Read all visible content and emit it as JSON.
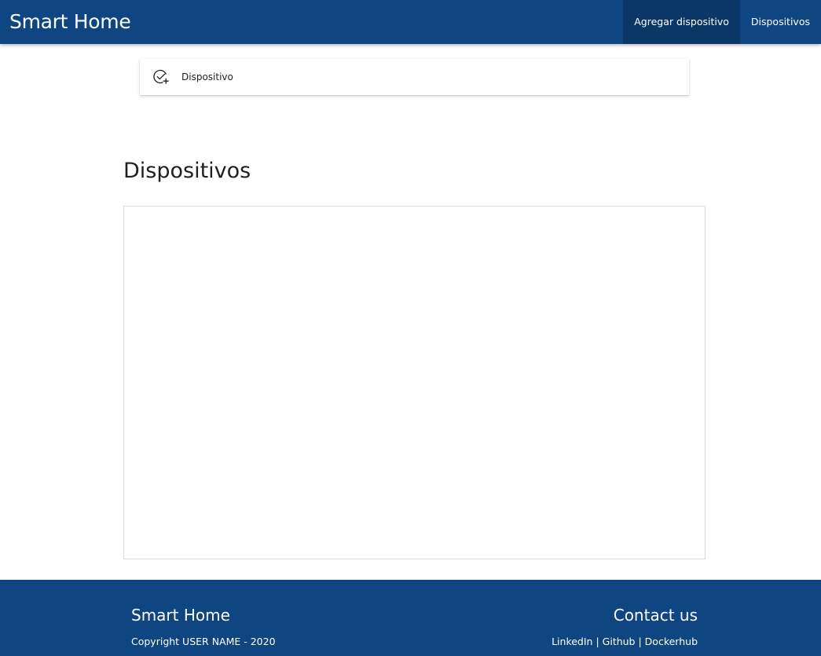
{
  "header": {
    "brand": "Smart Home",
    "nav": [
      {
        "label": "Agregar dispositivo"
      },
      {
        "label": "Dispositivos"
      }
    ]
  },
  "command_bar": {
    "add_device": {
      "label": "Dispositivo",
      "icon": "add-check-circle-icon"
    }
  },
  "main": {
    "title": "Dispositivos"
  },
  "footer": {
    "brand": "Smart Home",
    "copyright": "Copyright USER NAME - 2020",
    "contact_title": "Contact us",
    "links": [
      {
        "label": "LinkedIn"
      },
      {
        "label": "Github"
      },
      {
        "label": "Dockerhub"
      }
    ],
    "separator": " | "
  },
  "colors": {
    "primary": "#0f4580",
    "nav_active": "#0b3766",
    "text": "#201f1e"
  }
}
